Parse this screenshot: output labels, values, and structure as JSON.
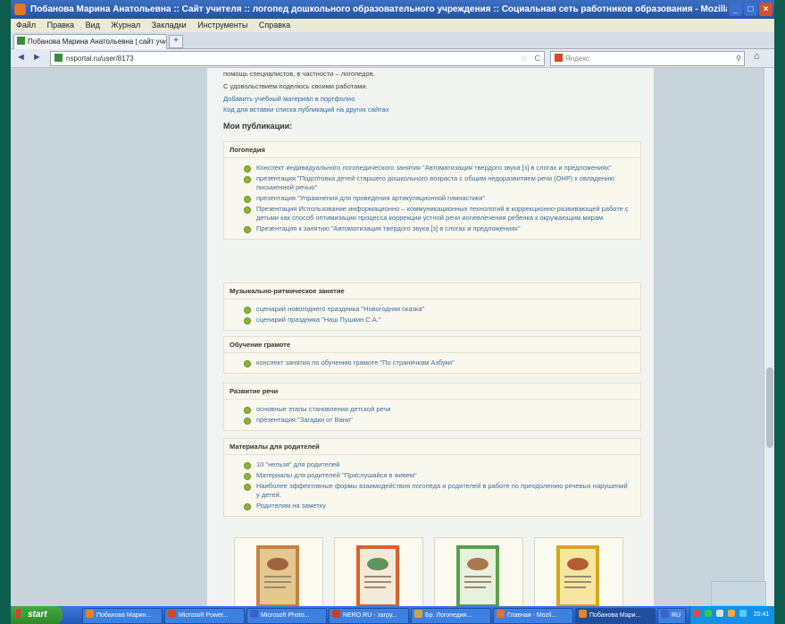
{
  "window": {
    "title": "Побанова Марина Анатольевна :: Сайт учителя :: логопед дошкольного образовательного учреждения :: Социальная сеть работников образования - Mozilla Firefox"
  },
  "menu": [
    "Файл",
    "Правка",
    "Вид",
    "Журнал",
    "Закладки",
    "Инструменты",
    "Справка"
  ],
  "tab": {
    "label": "Побанова Марина Анатольевна | сайт учи...",
    "new_tab": "+"
  },
  "nav": {
    "back": "◄",
    "forward": "►",
    "url": "nsportal.ru/user/8173",
    "search_placeholder": "Яндекс",
    "home": "⌂",
    "star": "☆",
    "reload": "C"
  },
  "page": {
    "intro": [
      {
        "text": "помощь специалистов, в частности – логопедов.",
        "link": false
      },
      {
        "text": "С удовольствием поделюсь своими работами.",
        "link": false
      },
      {
        "text": "Добавить учебный материал в портфолио",
        "link": true
      },
      {
        "text": "Код для вставки списка публикаций на других сайтах",
        "link": true
      }
    ],
    "publications_title": "Мои публикации:",
    "sections": [
      {
        "header": "Логопедия",
        "items": [
          "Конспект индивидуального логопедического занятия \"Автоматизация твердого звука [з] в слогах и предложениях\"",
          "презентация \"Подготовка детей старшего дошкольного возраста с общим недоразвитием речи (ОНР) к овладению письменной речью\"",
          "презентация \"Упражнения для проведения артикуляционной гимнастики\"",
          "Презентация Использование информационно – коммуникационных технологий в коррекционно-развивающей работе с детьми как способ оптимизации процесса коррекции устной речи иonевлечения ребенка к окружающим мирам",
          "Презентация к занятию \"Автоматизация твердого звука [з] в слогах и предложениях\""
        ]
      },
      {
        "header": "Музыкально-ритмическое занятие",
        "items": [
          "сценарий новогоднего праздника \"Новогодняя сказка\"",
          "сценарий праздника \"Наш Пушкин С.А.\""
        ]
      },
      {
        "header": "Обучение грамоте",
        "items": [
          "конспект занятия по обучению грамоте \"По страничкам Азбуки\""
        ]
      },
      {
        "header": "Развитие речи",
        "items": [
          "основные этапы становления детской речи",
          "презентация \"Загадки от Вани\""
        ]
      },
      {
        "header": "Материалы для родителей",
        "items": [
          "10 \"нельзя\" для родителей",
          "Материалы для родителей \"Прислушайся в живем\"",
          "Наиболее эффективные формы взаимодействия логопеда и родителей в работе по преодолению речевых нарушений у детей.",
          "Родителям на заметку"
        ]
      }
    ],
    "certificates": [
      {
        "name": "certificate-1",
        "color": "#c9823f",
        "inner": "#e4c890",
        "seal": "#8d4a2a"
      },
      {
        "name": "certificate-2",
        "color": "#d8622c",
        "inner": "#f4ead8",
        "seal": "#3b7e3e"
      },
      {
        "name": "certificate-3",
        "color": "#5aa04a",
        "inner": "#e8f1de",
        "seal": "#9a5a2a"
      },
      {
        "name": "certificate-4",
        "color": "#d9a520",
        "inner": "#f6e7a0",
        "seal": "#a53a1a"
      }
    ]
  },
  "taskbar": {
    "start": "start",
    "buttons": [
      {
        "label": "Побанова Марин...",
        "color": "#e88420"
      },
      {
        "label": "Microsoft Power...",
        "color": "#d24726"
      },
      {
        "label": "Microsoft Photo...",
        "color": "#3a62c9"
      },
      {
        "label": "NERO.RU - загру...",
        "color": "#cc3a2a"
      },
      {
        "label": "Бр. Логопедия...",
        "color": "#d8a23a"
      },
      {
        "label": "Главная - Mozil...",
        "color": "#e8702a"
      },
      {
        "label": "Побанова Мари...",
        "color": "#e88420"
      },
      {
        "label": "RU",
        "color": "#3a62c9"
      }
    ],
    "clock": "20:41"
  }
}
